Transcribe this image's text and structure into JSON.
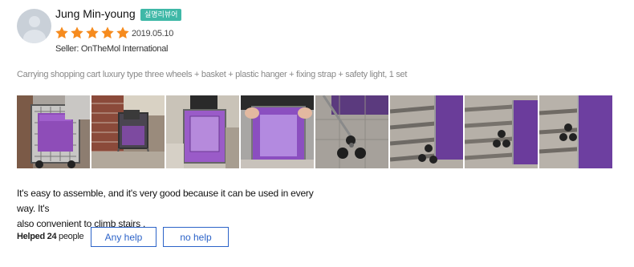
{
  "reviewer": {
    "name": "Jung Min-young",
    "badge": "실명리뷰어",
    "rating": 5,
    "date": "2019.05.10",
    "seller_label": "Seller: ",
    "seller_name": "OnTheMol International"
  },
  "product_option": "Carrying shopping cart luxury type three wheels + basket + plastic hanger + fixing strap + safety light, 1 set",
  "photos": [
    {
      "name": "review-photo-1"
    },
    {
      "name": "review-photo-2"
    },
    {
      "name": "review-photo-3"
    },
    {
      "name": "review-photo-4"
    },
    {
      "name": "review-photo-5"
    },
    {
      "name": "review-photo-6"
    },
    {
      "name": "review-photo-7"
    },
    {
      "name": "review-photo-8"
    }
  ],
  "review_text": {
    "line1": "It's easy to assemble, and it's very good because it can be used in every way. It's",
    "line2": "also convenient to climb stairs ."
  },
  "helpful": {
    "prefix": "Helped",
    "count": "24",
    "suffix": "people",
    "yes_label": "Any help",
    "no_label": "no help"
  },
  "colors": {
    "star": "#f68b1e",
    "badge": "#3fb8a7",
    "button": "#2c63c8"
  }
}
